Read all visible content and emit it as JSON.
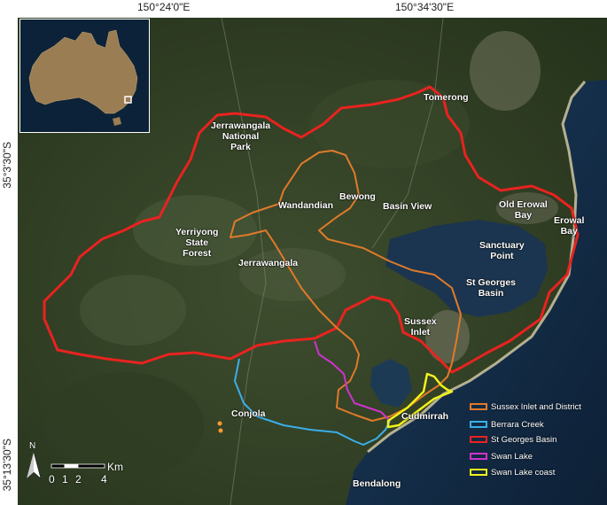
{
  "graticule": {
    "lon_labels": [
      "150°24'0\"E",
      "150°34'30\"E"
    ],
    "lat_labels": [
      "35°3'30\"S",
      "35°13'30\"S"
    ]
  },
  "places": [
    {
      "id": "tomerong",
      "label": "Tomerong"
    },
    {
      "id": "jerrawangala-np",
      "label": "Jerrawangala\nNational\nPark"
    },
    {
      "id": "bewong",
      "label": "Bewong"
    },
    {
      "id": "wandandian",
      "label": "Wandandian"
    },
    {
      "id": "basin-view",
      "label": "Basin View"
    },
    {
      "id": "old-erowal-bay",
      "label": "Old Erowal\nBay"
    },
    {
      "id": "erowal-bay",
      "label": "Erowal\nBay"
    },
    {
      "id": "yerriyong",
      "label": "Yerriyong\nState\nForest"
    },
    {
      "id": "sanctuary-point",
      "label": "Sanctuary\nPoint"
    },
    {
      "id": "jerrawangala",
      "label": "Jerrawangala"
    },
    {
      "id": "st-georges-basin",
      "label": "St Georges\nBasin"
    },
    {
      "id": "sussex-inlet",
      "label": "Sussex\nInlet"
    },
    {
      "id": "conjola",
      "label": "Conjola"
    },
    {
      "id": "cudmirrah",
      "label": "Cudmirrah"
    },
    {
      "id": "bendalong",
      "label": "Bendalong"
    }
  ],
  "legend": {
    "items": [
      {
        "label": "Sussex Inlet and District",
        "color": "#e07a2a"
      },
      {
        "label": "Berrara Creek",
        "color": "#3aaee8"
      },
      {
        "label": "St Georges Basin",
        "color": "#e8231f"
      },
      {
        "label": "Swan Lake",
        "color": "#cc33cc"
      },
      {
        "label": "Swan Lake coast",
        "color": "#f2f21a"
      }
    ]
  },
  "scale": {
    "unit": "Km",
    "ticks": [
      "0",
      "1",
      "2",
      "4"
    ]
  },
  "north_arrow": {
    "label": "N"
  },
  "colors": {
    "land_dark": "#2c3a22",
    "land_mid": "#3f5030",
    "water": "#122a44",
    "lake": "#1b3550",
    "sand": "#d9cfa8"
  }
}
